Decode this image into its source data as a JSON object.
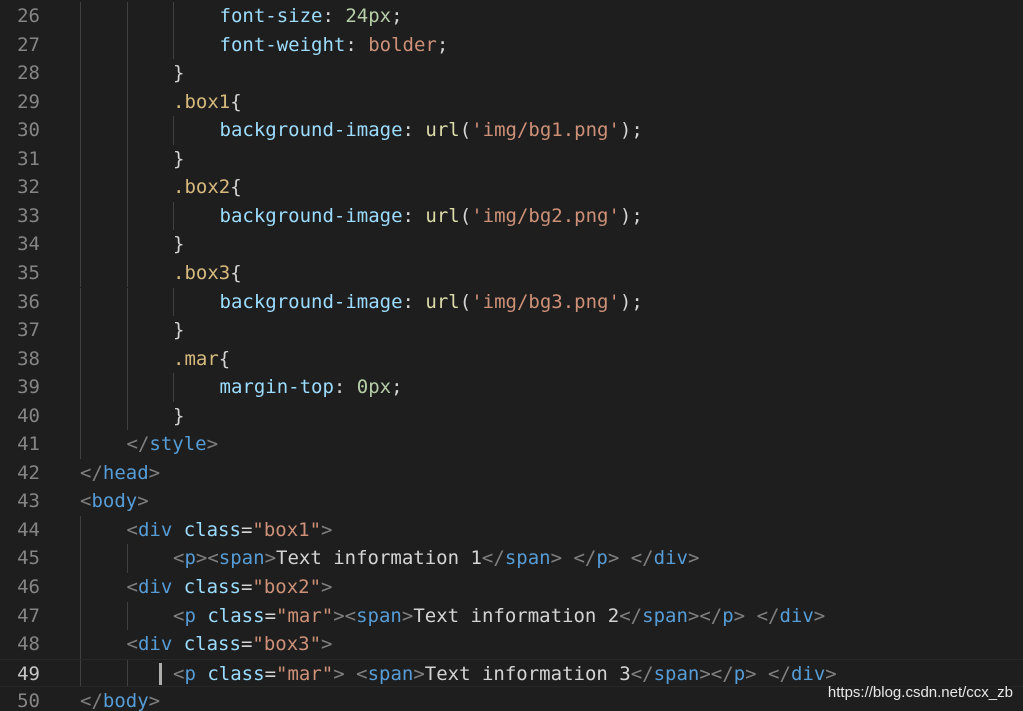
{
  "editor": {
    "theme": "dark",
    "colors": {
      "background": "#1e1e1e",
      "line_number": "#858585",
      "tag_bracket": "#808080",
      "tag_name": "#569cd6",
      "attribute": "#9cdcfe",
      "string": "#ce9178",
      "selector": "#d7ba7d",
      "property": "#9cdcfe",
      "function": "#dcdcaa",
      "number": "#b5cea8",
      "text": "#d4d4d4"
    },
    "current_line": 49,
    "lines": [
      {
        "num": "26",
        "indent": 3,
        "tokens": [
          [
            "pr",
            "font-size"
          ],
          [
            "pn",
            ": "
          ],
          [
            "nm",
            "24px"
          ],
          [
            "pn",
            ";"
          ]
        ]
      },
      {
        "num": "27",
        "indent": 3,
        "tokens": [
          [
            "pr",
            "font-weight"
          ],
          [
            "pn",
            ": "
          ],
          [
            "st",
            "bolder"
          ],
          [
            "pn",
            ";"
          ]
        ]
      },
      {
        "num": "28",
        "indent": 2,
        "tokens": [
          [
            "pn",
            "}"
          ]
        ]
      },
      {
        "num": "29",
        "indent": 2,
        "tokens": [
          [
            "sel",
            ".box1"
          ],
          [
            "pn",
            "{"
          ]
        ]
      },
      {
        "num": "30",
        "indent": 3,
        "tokens": [
          [
            "pr",
            "background-image"
          ],
          [
            "pn",
            ": "
          ],
          [
            "fn",
            "url"
          ],
          [
            "pn",
            "("
          ],
          [
            "st",
            "'img/bg1.png'"
          ],
          [
            "pn",
            ");"
          ]
        ]
      },
      {
        "num": "31",
        "indent": 2,
        "tokens": [
          [
            "pn",
            "}"
          ]
        ]
      },
      {
        "num": "32",
        "indent": 2,
        "tokens": [
          [
            "sel",
            ".box2"
          ],
          [
            "pn",
            "{"
          ]
        ]
      },
      {
        "num": "33",
        "indent": 3,
        "tokens": [
          [
            "pr",
            "background-image"
          ],
          [
            "pn",
            ": "
          ],
          [
            "fn",
            "url"
          ],
          [
            "pn",
            "("
          ],
          [
            "st",
            "'img/bg2.png'"
          ],
          [
            "pn",
            ");"
          ]
        ]
      },
      {
        "num": "34",
        "indent": 2,
        "tokens": [
          [
            "pn",
            "}"
          ]
        ]
      },
      {
        "num": "35",
        "indent": 2,
        "tokens": [
          [
            "sel",
            ".box3"
          ],
          [
            "pn",
            "{"
          ]
        ]
      },
      {
        "num": "36",
        "indent": 3,
        "tokens": [
          [
            "pr",
            "background-image"
          ],
          [
            "pn",
            ": "
          ],
          [
            "fn",
            "url"
          ],
          [
            "pn",
            "("
          ],
          [
            "st",
            "'img/bg3.png'"
          ],
          [
            "pn",
            ");"
          ]
        ]
      },
      {
        "num": "37",
        "indent": 2,
        "tokens": [
          [
            "pn",
            "}"
          ]
        ]
      },
      {
        "num": "38",
        "indent": 2,
        "tokens": [
          [
            "sel",
            ".mar"
          ],
          [
            "pn",
            "{"
          ]
        ]
      },
      {
        "num": "39",
        "indent": 3,
        "tokens": [
          [
            "pr",
            "margin-top"
          ],
          [
            "pn",
            ": "
          ],
          [
            "nm",
            "0px"
          ],
          [
            "pn",
            ";"
          ]
        ]
      },
      {
        "num": "40",
        "indent": 2,
        "tokens": [
          [
            "pn",
            "}"
          ]
        ]
      },
      {
        "num": "41",
        "indent": 1,
        "tokens": [
          [
            "t",
            "</"
          ],
          [
            "tn",
            "style"
          ],
          [
            "t",
            ">"
          ]
        ]
      },
      {
        "num": "42",
        "indent": 0,
        "tokens": [
          [
            "t",
            "</"
          ],
          [
            "tn",
            "head"
          ],
          [
            "t",
            ">"
          ]
        ]
      },
      {
        "num": "43",
        "indent": 0,
        "tokens": [
          [
            "t",
            "<"
          ],
          [
            "tn",
            "body"
          ],
          [
            "t",
            ">"
          ]
        ]
      },
      {
        "num": "44",
        "indent": 1,
        "tokens": [
          [
            "t",
            "<"
          ],
          [
            "tn",
            "div"
          ],
          [
            "tx",
            " "
          ],
          [
            "at",
            "class"
          ],
          [
            "pn",
            "="
          ],
          [
            "st",
            "\"box1\""
          ],
          [
            "t",
            ">"
          ]
        ]
      },
      {
        "num": "45",
        "indent": 2,
        "tokens": [
          [
            "t",
            "<"
          ],
          [
            "tn",
            "p"
          ],
          [
            "t",
            "><"
          ],
          [
            "tn",
            "span"
          ],
          [
            "t",
            ">"
          ],
          [
            "tx",
            "Text information 1"
          ],
          [
            "t",
            "</"
          ],
          [
            "tn",
            "span"
          ],
          [
            "t",
            ">"
          ],
          [
            "tx",
            " "
          ],
          [
            "t",
            "</"
          ],
          [
            "tn",
            "p"
          ],
          [
            "t",
            ">"
          ],
          [
            "tx",
            " "
          ],
          [
            "t",
            "</"
          ],
          [
            "tn",
            "div"
          ],
          [
            "t",
            ">"
          ]
        ]
      },
      {
        "num": "46",
        "indent": 1,
        "tokens": [
          [
            "t",
            "<"
          ],
          [
            "tn",
            "div"
          ],
          [
            "tx",
            " "
          ],
          [
            "at",
            "class"
          ],
          [
            "pn",
            "="
          ],
          [
            "st",
            "\"box2\""
          ],
          [
            "t",
            ">"
          ]
        ]
      },
      {
        "num": "47",
        "indent": 2,
        "tokens": [
          [
            "t",
            "<"
          ],
          [
            "tn",
            "p"
          ],
          [
            "tx",
            " "
          ],
          [
            "at",
            "class"
          ],
          [
            "pn",
            "="
          ],
          [
            "st",
            "\"mar\""
          ],
          [
            "t",
            "><"
          ],
          [
            "tn",
            "span"
          ],
          [
            "t",
            ">"
          ],
          [
            "tx",
            "Text information 2"
          ],
          [
            "t",
            "</"
          ],
          [
            "tn",
            "span"
          ],
          [
            "t",
            "></"
          ],
          [
            "tn",
            "p"
          ],
          [
            "t",
            ">"
          ],
          [
            "tx",
            " "
          ],
          [
            "t",
            "</"
          ],
          [
            "tn",
            "div"
          ],
          [
            "t",
            ">"
          ]
        ]
      },
      {
        "num": "48",
        "indent": 1,
        "tokens": [
          [
            "t",
            "<"
          ],
          [
            "tn",
            "div"
          ],
          [
            "tx",
            " "
          ],
          [
            "at",
            "class"
          ],
          [
            "pn",
            "="
          ],
          [
            "st",
            "\"box3\""
          ],
          [
            "t",
            ">"
          ]
        ]
      },
      {
        "num": "49",
        "indent": 2,
        "tokens": [
          [
            "t",
            "<"
          ],
          [
            "tn",
            "p"
          ],
          [
            "tx",
            " "
          ],
          [
            "at",
            "class"
          ],
          [
            "pn",
            "="
          ],
          [
            "st",
            "\"mar\""
          ],
          [
            "t",
            ">"
          ],
          [
            "tx",
            " "
          ],
          [
            "t",
            "<"
          ],
          [
            "tn",
            "span"
          ],
          [
            "t",
            ">"
          ],
          [
            "tx",
            "Text information 3"
          ],
          [
            "t",
            "</"
          ],
          [
            "tn",
            "span"
          ],
          [
            "t",
            "></"
          ],
          [
            "tn",
            "p"
          ],
          [
            "t",
            ">"
          ],
          [
            "tx",
            " "
          ],
          [
            "t",
            "</"
          ],
          [
            "tn",
            "div"
          ],
          [
            "t",
            ">"
          ]
        ]
      },
      {
        "num": "50",
        "indent": 0,
        "tokens": [
          [
            "t",
            "</"
          ],
          [
            "tn",
            "body"
          ],
          [
            "t",
            ">"
          ]
        ]
      }
    ]
  },
  "watermark": {
    "text": "https://blog.csdn.net/ccx_zb"
  }
}
